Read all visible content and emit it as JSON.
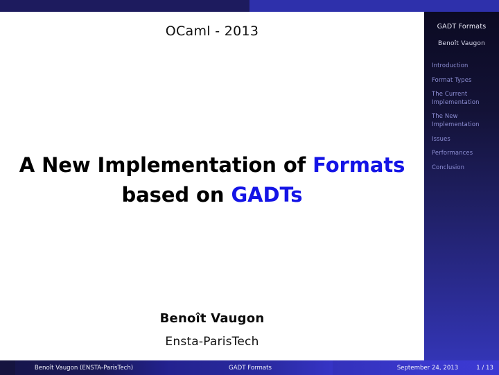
{
  "topbar": {
    "left_color": "#1d1b5e",
    "right_color": "#2e30ab"
  },
  "sidebar": {
    "title": "GADT Formats",
    "author": "Benoît Vaugon",
    "items": [
      {
        "label": "Introduction"
      },
      {
        "label": "Format Types"
      },
      {
        "label": "The Current Implementation"
      },
      {
        "label": "The New Implementation"
      },
      {
        "label": "Issues"
      },
      {
        "label": "Performances"
      },
      {
        "label": "Conclusion"
      }
    ],
    "text_color": "#8d8ed4",
    "title_color": "#e9e9f5"
  },
  "main": {
    "heading": "OCaml - 2013",
    "title_line1_plain": "A New Implementation of ",
    "title_line1_highlight": "Formats",
    "title_line2_plain": "based on ",
    "title_line2_highlight": "GADTs",
    "highlight_color": "#1414e6",
    "author_name": "Benoît Vaugon",
    "author_institution": "Ensta-ParisTech"
  },
  "footer": {
    "author": "Benoît Vaugon  (ENSTA-ParisTech)",
    "title": "GADT Formats",
    "date": "September 24, 2013",
    "page": "1 / 13"
  }
}
